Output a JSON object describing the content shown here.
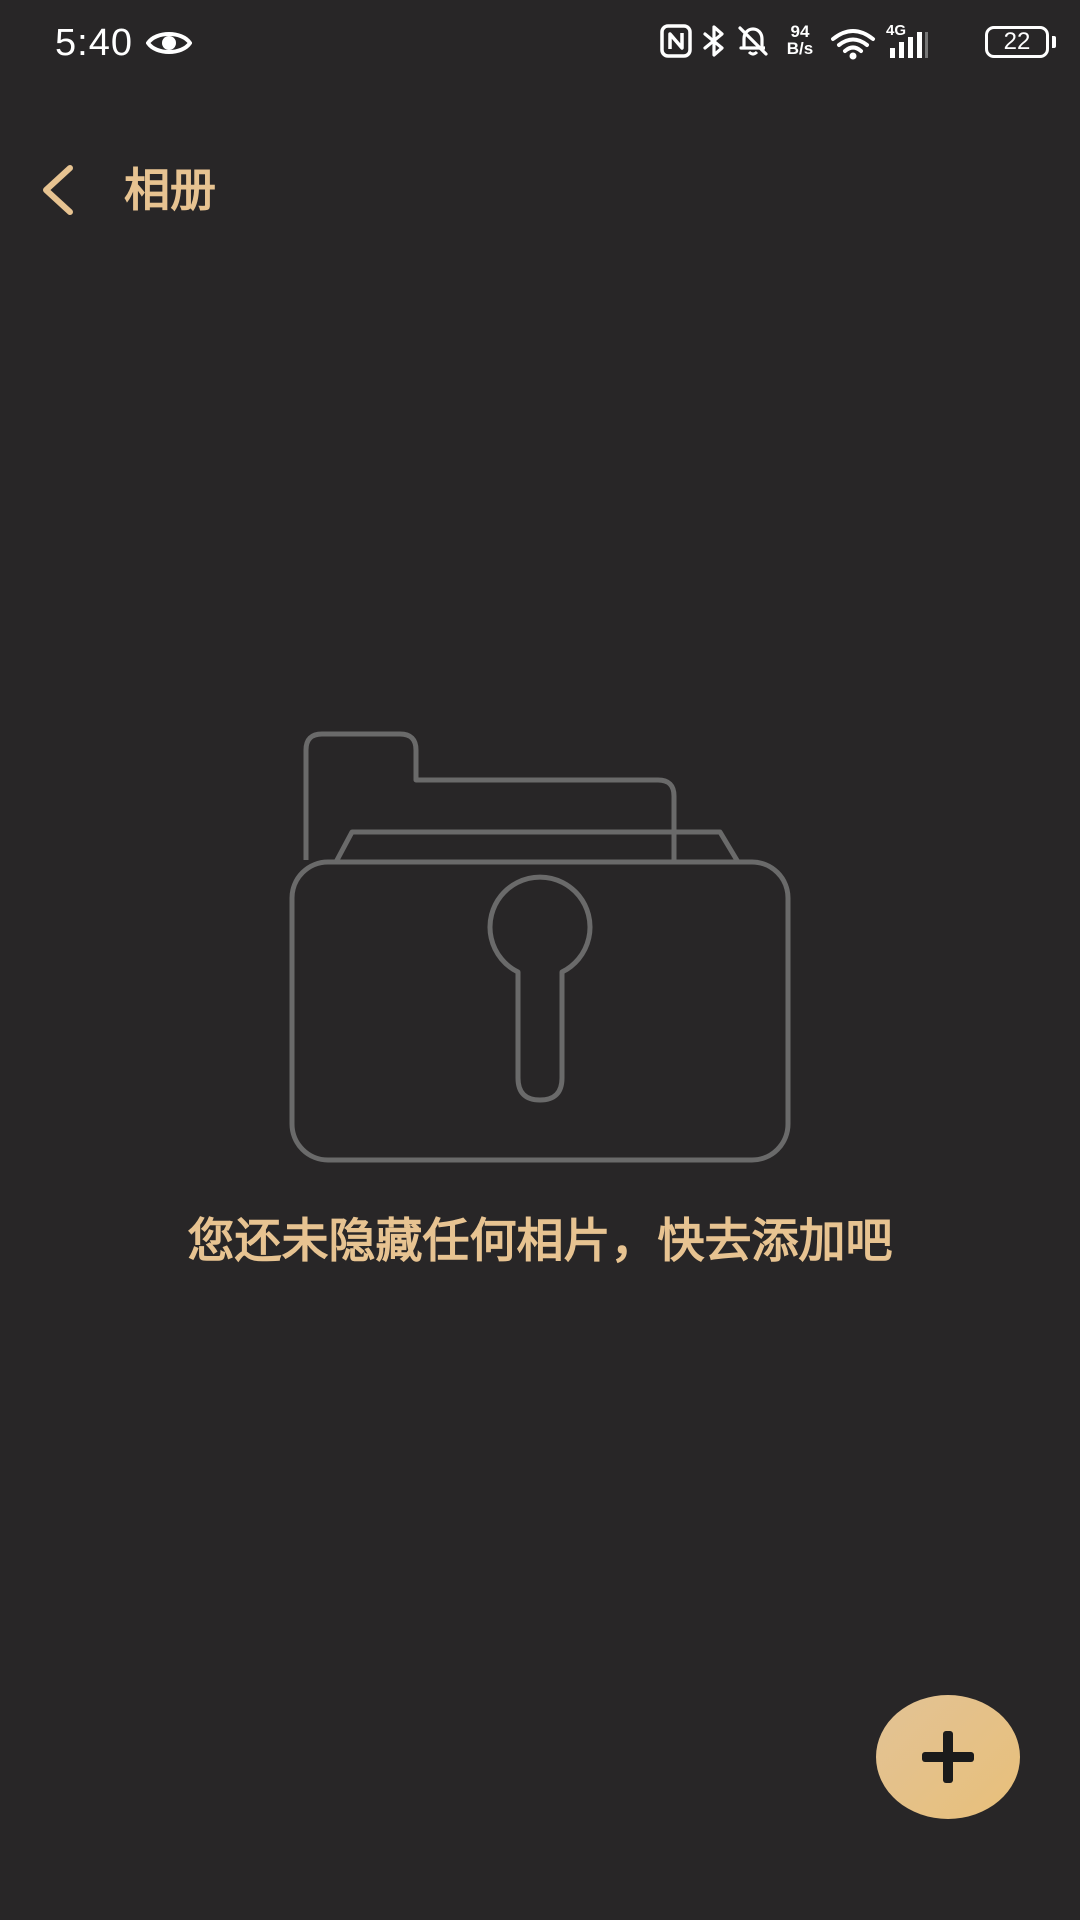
{
  "status_bar": {
    "time": "5:40",
    "net_speed_value": "94",
    "net_speed_unit": "B/s",
    "network_type": "4G",
    "battery_level": "22",
    "icons": [
      "eye-icon",
      "nfc-icon",
      "bluetooth-icon",
      "mute-icon",
      "wifi-icon",
      "signal-icon",
      "battery-icon"
    ]
  },
  "header": {
    "back_icon": "chevron-left-icon",
    "title": "相册"
  },
  "empty_state": {
    "icon": "locked-folder-icon",
    "message": "您还未隐藏任何相片，快去添加吧"
  },
  "fab": {
    "icon": "plus-icon"
  },
  "colors": {
    "background": "#282627",
    "accent": "#e7c391",
    "illustration_stroke": "#6a6a6a",
    "fab_fill": "#e5c187"
  }
}
